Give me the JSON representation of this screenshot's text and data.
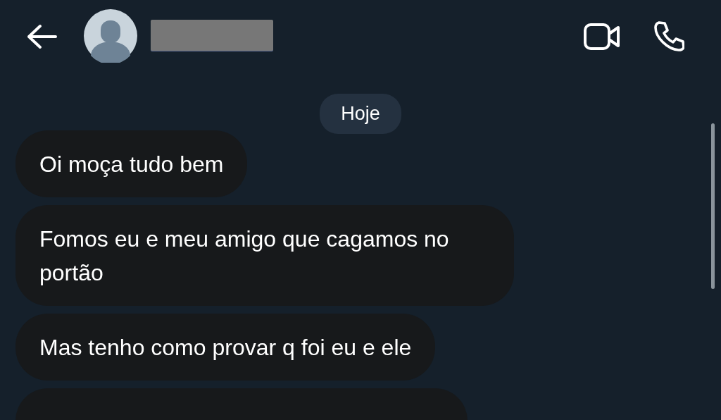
{
  "header": {
    "has_avatar": true,
    "name_redacted": true
  },
  "date_divider": "Hoje",
  "messages": [
    {
      "text": "Oi moça tudo bem"
    },
    {
      "text": "Fomos eu e meu amigo que cagamos no portão"
    },
    {
      "text": "Mas tenho como provar q foi eu e ele"
    }
  ]
}
